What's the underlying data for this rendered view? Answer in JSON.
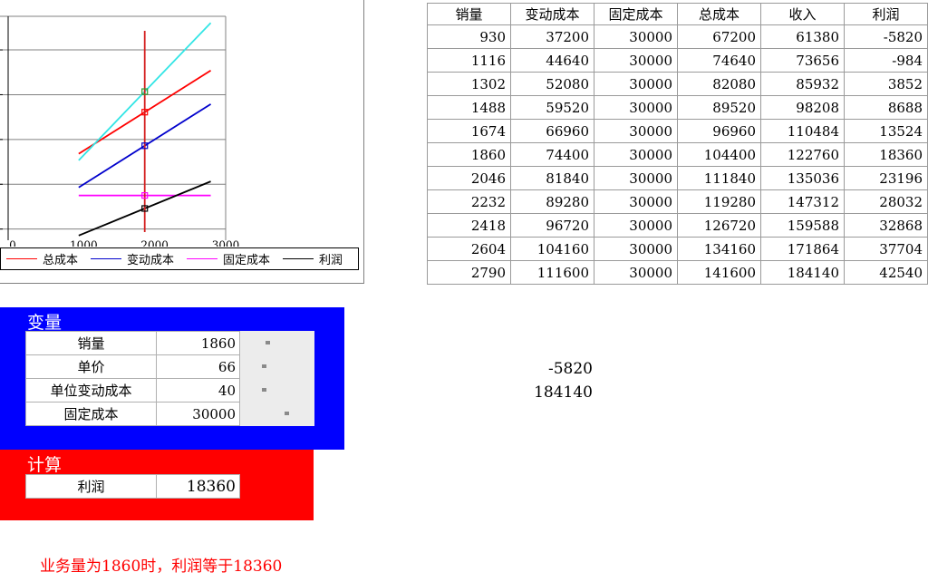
{
  "chart_data": {
    "type": "line",
    "title": "",
    "xlabel": "",
    "ylabel": "",
    "xlim": [
      0,
      3000
    ],
    "xticks": [
      "0",
      "1000",
      "2000",
      "3000"
    ],
    "grid": true,
    "legend_position": "bottom",
    "marker_x": 1860,
    "series": [
      {
        "name": "总成本",
        "color": "#ff0000",
        "x": [
          930,
          2790
        ],
        "y": [
          67200,
          141600
        ],
        "marker_y": 104400
      },
      {
        "name": "变动成本",
        "color": "#0000cc",
        "x": [
          930,
          2790
        ],
        "y": [
          37200,
          111600
        ],
        "marker_y": 74400
      },
      {
        "name": "固定成本",
        "color": "#ff00ff",
        "x": [
          930,
          2790
        ],
        "y": [
          30000,
          30000
        ],
        "marker_y": 30000
      },
      {
        "name": "利润",
        "color": "#000000",
        "x": [
          930,
          2790
        ],
        "y": [
          -5820,
          42540
        ],
        "marker_y": 18360
      },
      {
        "name": "",
        "color": "#33e5e5",
        "x": [
          930,
          2790
        ],
        "y": [
          61380,
          184140
        ],
        "marker_y": 122760
      }
    ]
  },
  "table": {
    "headers": [
      "销量",
      "变动成本",
      "固定成本",
      "总成本",
      "收入",
      "利润"
    ],
    "rows": [
      [
        "930",
        "37200",
        "30000",
        "67200",
        "61380",
        "-5820"
      ],
      [
        "1116",
        "44640",
        "30000",
        "74640",
        "73656",
        "-984"
      ],
      [
        "1302",
        "52080",
        "30000",
        "82080",
        "85932",
        "3852"
      ],
      [
        "1488",
        "59520",
        "30000",
        "89520",
        "98208",
        "8688"
      ],
      [
        "1674",
        "66960",
        "30000",
        "96960",
        "110484",
        "13524"
      ],
      [
        "1860",
        "74400",
        "30000",
        "104400",
        "122760",
        "18360"
      ],
      [
        "2046",
        "81840",
        "30000",
        "111840",
        "135036",
        "23196"
      ],
      [
        "2232",
        "89280",
        "30000",
        "119280",
        "147312",
        "28032"
      ],
      [
        "2418",
        "96720",
        "30000",
        "126720",
        "159588",
        "32868"
      ],
      [
        "2604",
        "104160",
        "30000",
        "134160",
        "171864",
        "37704"
      ],
      [
        "2790",
        "111600",
        "30000",
        "141600",
        "184140",
        "42540"
      ]
    ]
  },
  "variables": {
    "title": "变量",
    "rows": [
      {
        "label": "销量",
        "value": "1860",
        "slider": 0.34
      },
      {
        "label": "单价",
        "value": "66",
        "slider": 0.28
      },
      {
        "label": "单位变动成本",
        "value": "40",
        "slider": 0.28
      },
      {
        "label": "固定成本",
        "value": "30000",
        "slider": 0.64
      }
    ]
  },
  "calc": {
    "title": "计算",
    "label": "利润",
    "value": "18360"
  },
  "floating": {
    "min_value": "-5820",
    "max_value": "184140"
  },
  "status": "业务量为1860时，利润等于18360"
}
